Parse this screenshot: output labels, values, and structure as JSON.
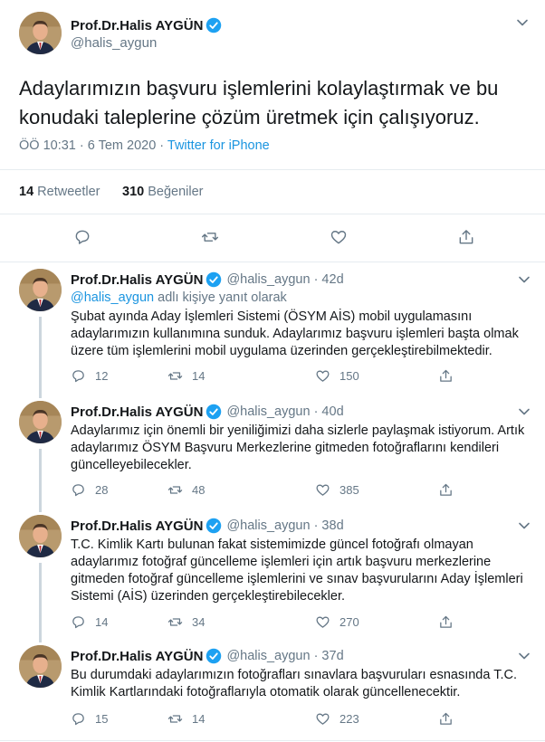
{
  "author": {
    "name": "Prof.Dr.Halis AYGÜN",
    "handle": "@halis_aygun",
    "verified": true
  },
  "main_tweet": {
    "text": "Adaylarımızın başvuru işlemlerini kolaylaştırmak ve bu konudaki taleplerine çözüm üretmek için çalışıyoruz.",
    "timestamp": "ÖÖ 10:31 · 6 Tem 2020 · ",
    "source": "Twitter for iPhone",
    "retweets_count": "14",
    "retweets_label": " Retweetler",
    "likes_count": "310",
    "likes_label": " Beğeniler"
  },
  "replies": [
    {
      "name": "Prof.Dr.Halis AYGÜN",
      "handle": "@halis_aygun · 42d",
      "replying_mention": "@halis_aygun",
      "replying_suffix": " adlı kişiye yanıt olarak",
      "text": "Şubat ayında Aday İşlemleri Sistemi (ÖSYM AİS) mobil uygulamasını adaylarımızın kullanımına sunduk. Adaylarımız başvuru işlemleri başta olmak üzere tüm işlemlerini mobil uygulama üzerinden gerçekleştirebilmektedir.",
      "replies": "12",
      "retweets": "14",
      "likes": "150"
    },
    {
      "name": "Prof.Dr.Halis AYGÜN",
      "handle": "@halis_aygun · 40d",
      "text": "Adaylarımız için önemli bir yeniliğimizi  daha sizlerle paylaşmak istiyorum. Artık adaylarımız ÖSYM Başvuru Merkezlerine gitmeden fotoğraflarını kendileri güncelleyebilecekler.",
      "replies": "28",
      "retweets": "48",
      "likes": "385"
    },
    {
      "name": "Prof.Dr.Halis AYGÜN",
      "handle": "@halis_aygun · 38d",
      "text": "T.C. Kimlik Kartı bulunan fakat sistemimizde güncel fotoğrafı olmayan adaylarımız fotoğraf güncelleme işlemleri için artık başvuru merkezlerine gitmeden fotoğraf güncelleme işlemlerini ve sınav başvurularını Aday İşlemleri Sistemi (AİS) üzerinden gerçekleştirebilecekler.",
      "replies": "14",
      "retweets": "34",
      "likes": "270"
    },
    {
      "name": "Prof.Dr.Halis AYGÜN",
      "handle": "@halis_aygun · 37d",
      "text": "Bu durumdaki adaylarımızın fotoğrafları sınavlara başvuruları esnasında T.C. Kimlik Kartlarındaki fotoğraflarıyla otomatik olarak güncellenecektir.",
      "replies": "15",
      "retweets": "14",
      "likes": "223"
    }
  ],
  "icons": {
    "reply": "speech-bubble-icon",
    "retweet": "retweet-arrows-icon",
    "like": "heart-icon",
    "share": "share-upload-icon",
    "verified": "verified-badge-icon",
    "more": "chevron-down-icon"
  },
  "colors": {
    "link": "#1b95e0",
    "verified": "#1da1f2",
    "muted": "#657786",
    "text": "#14171a",
    "divider": "#e6ecf0"
  }
}
